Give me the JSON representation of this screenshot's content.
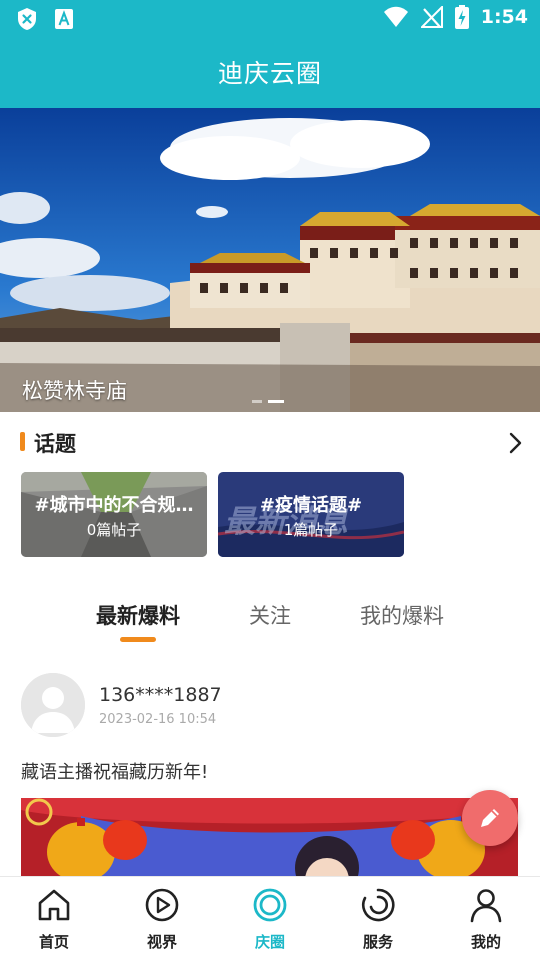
{
  "status_bar": {
    "time": "1:54",
    "left_icons": [
      "shield-x-icon",
      "font-a-icon"
    ],
    "right_icons": [
      "wifi-icon",
      "no-signal-icon",
      "battery-charging-icon"
    ]
  },
  "header": {
    "title": "迪庆云圈",
    "background_color": "#1cb8c8"
  },
  "banner": {
    "caption": "松赞林寺庙",
    "slide_count": 2,
    "active_slide": 2
  },
  "topics": {
    "title": "话题",
    "more_icon": "chevron-right-icon",
    "items": [
      {
        "title": "#城市中的不合规…",
        "count": "0篇帖子"
      },
      {
        "title": "#疫情话题#",
        "count": "1篇帖子",
        "bg_text": "最新消息"
      }
    ]
  },
  "tabs": [
    {
      "label": "最新爆料",
      "active": true
    },
    {
      "label": "关注",
      "active": false
    },
    {
      "label": "我的爆料",
      "active": false
    }
  ],
  "post": {
    "username": "136****1887",
    "timestamp": "2023-02-16 10:54",
    "text": "藏语主播祝福藏历新年!"
  },
  "fab": {
    "icon": "pencil-icon"
  },
  "bottom_nav": [
    {
      "label": "首页",
      "icon": "home-icon",
      "active": false
    },
    {
      "label": "视界",
      "icon": "play-circle-icon",
      "active": false
    },
    {
      "label": "庆圈",
      "icon": "ring-icon",
      "active": true
    },
    {
      "label": "服务",
      "icon": "service-swirl-icon",
      "active": false
    },
    {
      "label": "我的",
      "icon": "user-icon",
      "active": false
    }
  ],
  "colors": {
    "accent": "#1cb8c8",
    "highlight": "#f08a1c",
    "fab": "#f06c6c"
  }
}
